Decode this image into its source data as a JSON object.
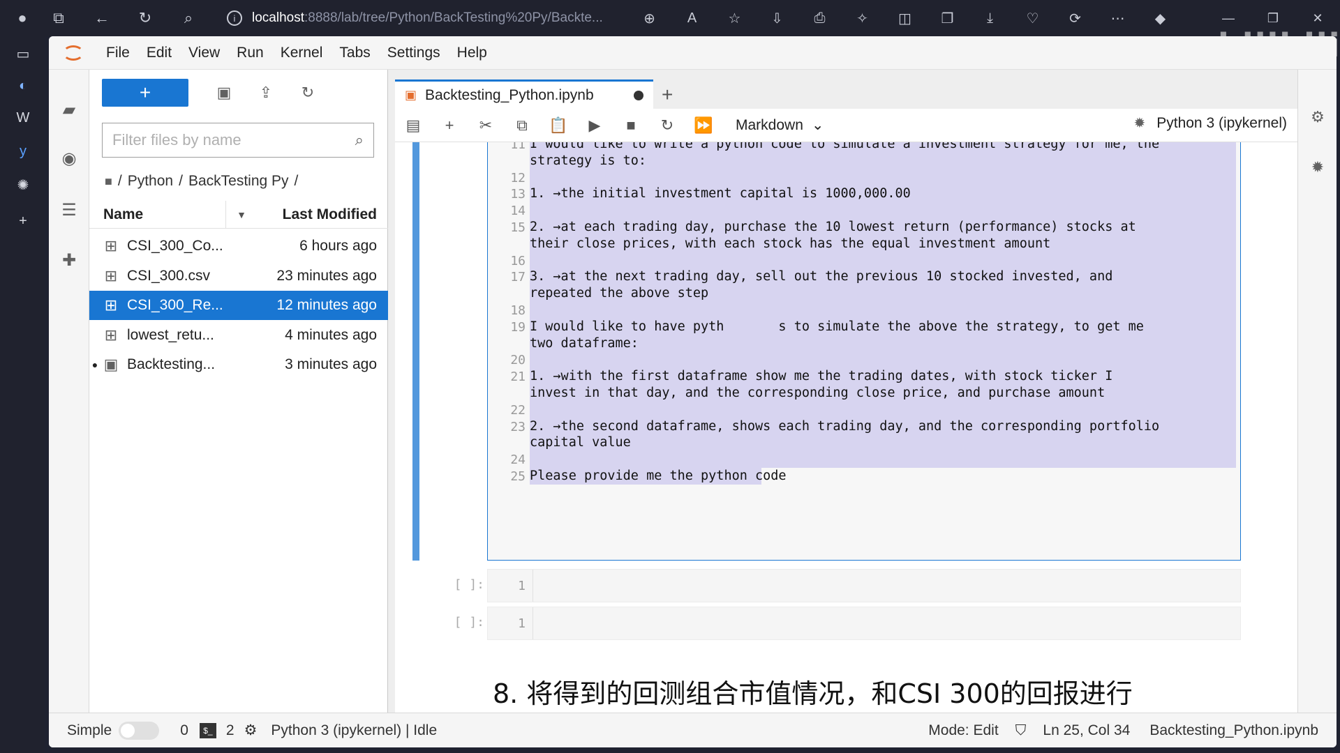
{
  "browser": {
    "address_host": "localhost",
    "address_path": ":8888/lab/tree/Python/BackTesting%20Py/Backte...",
    "watermark": "bilibili"
  },
  "menu": [
    "File",
    "Edit",
    "View",
    "Run",
    "Kernel",
    "Tabs",
    "Settings",
    "Help"
  ],
  "filebrowser": {
    "filter_placeholder": "Filter files by name",
    "breadcrumb": [
      "/",
      "Python",
      "/",
      "BackTesting Py",
      "/"
    ],
    "col_name": "Name",
    "col_modified": "Last Modified",
    "files": [
      {
        "name": "CSI_300_Co...",
        "modified": "6 hours ago",
        "selected": false,
        "running": false
      },
      {
        "name": "CSI_300.csv",
        "modified": "23 minutes ago",
        "selected": false,
        "running": false
      },
      {
        "name": "CSI_300_Re...",
        "modified": "12 minutes ago",
        "selected": true,
        "running": false
      },
      {
        "name": "lowest_retu...",
        "modified": "4 minutes ago",
        "selected": false,
        "running": false
      },
      {
        "name": "Backtesting...",
        "modified": "3 minutes ago",
        "selected": false,
        "running": true
      }
    ]
  },
  "notebook": {
    "tab_title": "Backtesting_Python.ipynb",
    "cell_type": "Markdown",
    "kernel_name": "Python 3 (ipykernel)",
    "markdown_lines": [
      {
        "n": "11",
        "text": "I would like to write a python code to simulate a investment strategy for me, the"
      },
      {
        "n": "",
        "text": "strategy is to:"
      },
      {
        "n": "12",
        "text": ""
      },
      {
        "n": "13",
        "text": "1. →the initial investment capital is 1000,000.00"
      },
      {
        "n": "14",
        "text": ""
      },
      {
        "n": "15",
        "text": "2. →at each trading day, purchase the 10 lowest return (performance) stocks at"
      },
      {
        "n": "",
        "text": "their close prices, with each stock has the equal investment amount"
      },
      {
        "n": "16",
        "text": ""
      },
      {
        "n": "17",
        "text": "3. →at the next trading day, sell out the previous 10 stocked invested, and"
      },
      {
        "n": "",
        "text": "repeated the above step"
      },
      {
        "n": "18",
        "text": ""
      },
      {
        "n": "19",
        "text": "I would like to have pyth       s to simulate the above the strategy, to get me"
      },
      {
        "n": "",
        "text": "two dataframe:"
      },
      {
        "n": "20",
        "text": ""
      },
      {
        "n": "21",
        "text": "1. →with the first dataframe show me the trading dates, with stock ticker I"
      },
      {
        "n": "",
        "text": "invest in that day, and the corresponding close price, and purchase amount"
      },
      {
        "n": "22",
        "text": ""
      },
      {
        "n": "23",
        "text": "2. →the second dataframe, shows each trading day, and the corresponding portfolio"
      },
      {
        "n": "",
        "text": "capital value"
      },
      {
        "n": "24",
        "text": ""
      },
      {
        "n": "25",
        "text": "Please provide me the python code"
      }
    ],
    "empty_cells": [
      {
        "prompt": "[ ]:",
        "line": "1"
      },
      {
        "prompt": "[ ]:",
        "line": "1"
      }
    ],
    "next_heading": "8. 将得到的回测组合市值情况，和CSI 300的回报进行"
  },
  "status": {
    "simple_label": "Simple",
    "terminals": "0",
    "kernels": "2",
    "kernel_status": "Python 3 (ipykernel) | Idle",
    "mode": "Mode: Edit",
    "cursor": "Ln 25, Col 34",
    "filename": "Backtesting_Python.ipynb"
  }
}
